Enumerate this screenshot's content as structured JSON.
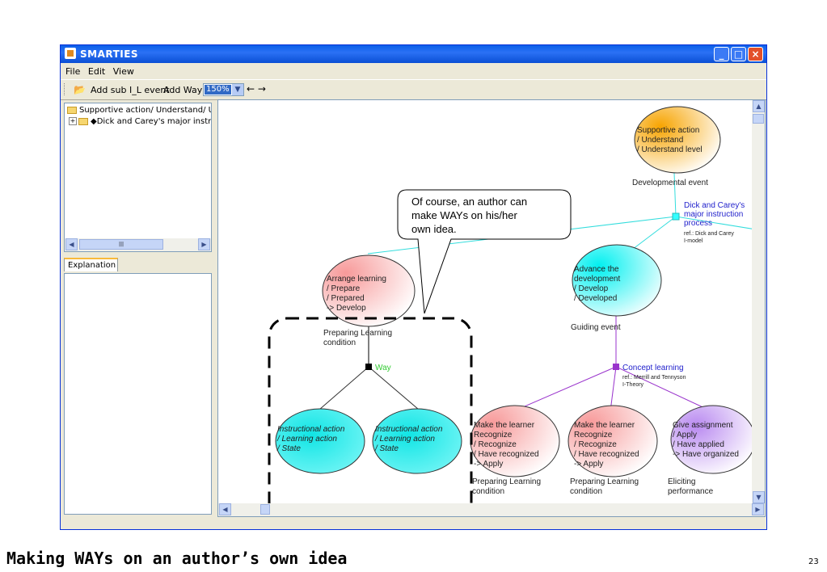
{
  "window": {
    "title": "SMARTIES",
    "menu": [
      "File",
      "Edit",
      "View"
    ],
    "toolbar": {
      "add_sub_label": "Add sub I_L event",
      "add_way_label": "Add Way",
      "zoom_value": "150%",
      "back_arrow": "←",
      "forward_arrow": "→"
    },
    "tree": {
      "row1": "Supportive action/ Understand/ U",
      "row2": "◆Dick and Carey's major instr"
    },
    "explanation_tab": "Explanation"
  },
  "diagram": {
    "callout_lines": [
      "Of course, an author can",
      "make WAYs on his/her",
      "own idea."
    ],
    "nodes": {
      "supportive": {
        "lines": [
          "Supportive action",
          "/ Understand",
          "/ Understand level"
        ],
        "caption": "Developmental event",
        "color": "#f2b400"
      },
      "dick": {
        "lines": [
          "Dick and Carey's",
          "major instruction",
          "process"
        ],
        "ref": [
          "ref.: Dick and Carey",
          "I-model"
        ]
      },
      "arrange": {
        "lines": [
          "Arrange learning",
          "/ Prepare",
          "/ Prepared",
          "-> Develop"
        ],
        "caption": [
          "Preparing Learning",
          "condition"
        ]
      },
      "advance": {
        "lines": [
          "Advance the",
          "development",
          "/ Develop",
          "/ Developed"
        ],
        "caption": "Guiding event"
      },
      "way": {
        "label": "Way",
        "color": "#33cc33"
      },
      "concept": {
        "label": "Concept learning",
        "ref": [
          "ref.: Merrill and Tennyson",
          "I-Theory"
        ],
        "color": "#9933cc"
      },
      "instr1": {
        "lines": [
          "Instructional action",
          "/ Learning action",
          "/ State"
        ]
      },
      "instr2": {
        "lines": [
          "Instructional action",
          "/ Learning action",
          "/ State"
        ]
      },
      "recog1": {
        "lines": [
          "Make the learner",
          "Recognize",
          "/ Recognize",
          "/ Have recognized",
          "-> Apply"
        ],
        "caption": [
          "Preparing Learning",
          "condition"
        ]
      },
      "recog2": {
        "lines": [
          "Make the learner",
          "Recognize",
          "/ Recognize",
          "/ Have recognized",
          "-> Apply"
        ],
        "caption": [
          "Preparing Learning",
          "condition"
        ]
      },
      "assign": {
        "lines": [
          "Give assignment",
          "/ Apply",
          "/ Have applied",
          "-> Have organized"
        ],
        "caption": [
          "Eliciting",
          "performance"
        ]
      }
    }
  },
  "slide": {
    "caption": "Making WAYs on an author’s own idea",
    "page_number": "23"
  }
}
